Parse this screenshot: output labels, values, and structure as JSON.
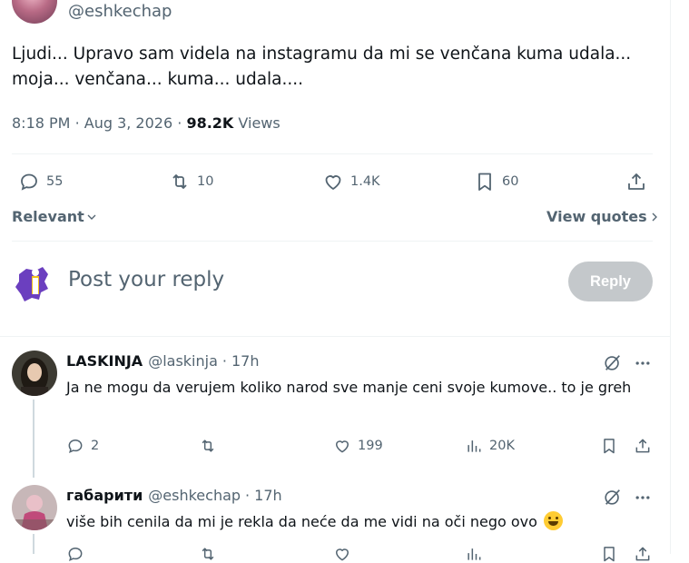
{
  "tweet": {
    "handle": "@eshkechap",
    "text": "Ljudi... Upravo sam videla na instagramu da mi se venčana kuma udala... moja... venčana... kuma... udala....",
    "time": "8:18 PM",
    "date": "Aug 3, 2026",
    "views_count": "98.2K",
    "views_label": "Views",
    "sep": "·",
    "actions": {
      "replies": "55",
      "retweets": "10",
      "likes": "1.4K",
      "bookmarks": "60"
    }
  },
  "sort": {
    "label": "Relevant"
  },
  "view_quotes": {
    "label": "View quotes"
  },
  "reply_box": {
    "placeholder": "Post your reply",
    "button": "Reply"
  },
  "comments": [
    {
      "name": "LASKINJA",
      "handle": "@laskinja",
      "time": "17h",
      "sep": "·",
      "text": "Ja ne mogu da verujem koliko narod sve manje ceni svoje kumove.. to je greh",
      "replies": "2",
      "retweets": "",
      "likes": "199",
      "views": "20K"
    },
    {
      "name": "габарити",
      "handle": "@eshkechap",
      "time": "17h",
      "sep": "·",
      "text": "više bih cenila da mi je rekla da neće da me vidi na oči nego ovo",
      "emoji": "smiling-face-emoji"
    }
  ],
  "colors": {
    "text": "#0f1419",
    "secondary": "#536471",
    "divider": "#eff3f4",
    "reply_button_disabled": "#c4c8cb"
  }
}
